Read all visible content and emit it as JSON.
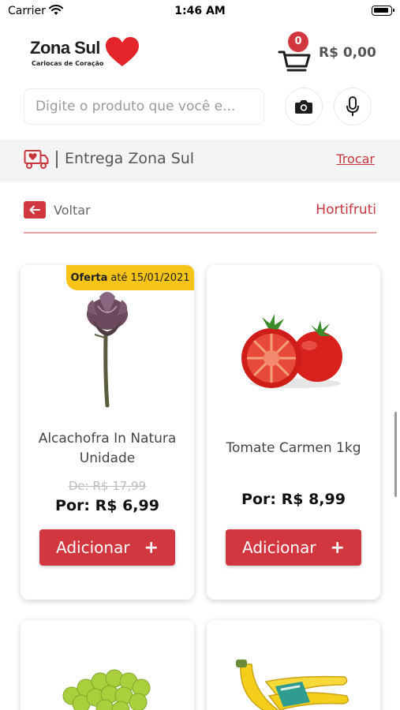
{
  "status_bar": {
    "carrier": "Carrier",
    "time": "1:46 AM"
  },
  "brand": {
    "name": "Zona Sul",
    "tagline": "Cariocas de Coração",
    "color": "#d2363f"
  },
  "cart": {
    "count": "0",
    "total": "R$ 0,00"
  },
  "search": {
    "placeholder": "Digite o produto que você e..."
  },
  "delivery": {
    "label": "Entrega Zona Sul",
    "action": "Trocar"
  },
  "breadcrumb": {
    "back": "Voltar",
    "category": "Hortifruti"
  },
  "products": [
    {
      "name": "Alcachofra In Natura Unidade",
      "offer_label": "Oferta",
      "offer_until": "até 15/01/2021",
      "old_price": "De: R$ 17,99",
      "price": "Por: R$ 6,99",
      "button": "Adicionar",
      "button_icon": "+"
    },
    {
      "name": "Tomate Carmen 1kg",
      "price": "Por: R$ 8,99",
      "button": "Adicionar",
      "button_icon": "+"
    },
    {
      "image": "grapes"
    },
    {
      "image": "bananas"
    }
  ]
}
